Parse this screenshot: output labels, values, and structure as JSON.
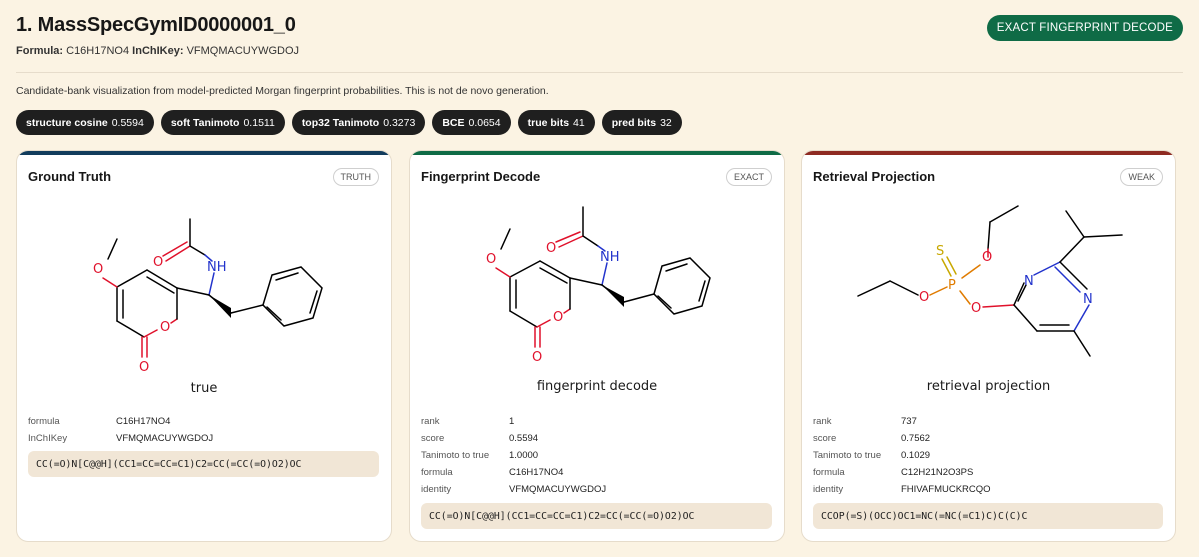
{
  "header": {
    "title": "1. MassSpecGymID0000001_0",
    "formula_label": "Formula:",
    "formula_value": "C16H17NO4",
    "inchikey_label": "InChIKey:",
    "inchikey_value": "VFMQMACUYWGDOJ",
    "mode_button": "EXACT FINGERPRINT DECODE"
  },
  "caption": "Candidate-bank visualization from model-predicted Morgan fingerprint probabilities. This is not de novo generation.",
  "metrics": [
    {
      "key": "structure cosine",
      "value": "0.5594"
    },
    {
      "key": "soft Tanimoto",
      "value": "0.1511"
    },
    {
      "key": "top32 Tanimoto",
      "value": "0.3273"
    },
    {
      "key": "BCE",
      "value": "0.0654"
    },
    {
      "key": "true bits",
      "value": "41"
    },
    {
      "key": "pred bits",
      "value": "32"
    }
  ],
  "cards": [
    {
      "title": "Ground Truth",
      "badge": "TRUTH",
      "accent": "#123c5c",
      "mol_label": "true",
      "props": [
        {
          "k": "formula",
          "v": "C16H17NO4"
        },
        {
          "k": "InChIKey",
          "v": "VFMQMACUYWGDOJ"
        }
      ],
      "smiles": "CC(=O)N[C@@H](CC1=CC=CC=C1)C2=CC(=CC(=O)O2)OC"
    },
    {
      "title": "Fingerprint Decode",
      "badge": "EXACT",
      "accent": "#0f6b46",
      "mol_label": "fingerprint decode",
      "props": [
        {
          "k": "rank",
          "v": "1"
        },
        {
          "k": "score",
          "v": "0.5594"
        },
        {
          "k": "Tanimoto to true",
          "v": "1.0000"
        },
        {
          "k": "formula",
          "v": "C16H17NO4"
        },
        {
          "k": "identity",
          "v": "VFMQMACUYWGDOJ"
        }
      ],
      "smiles": "CC(=O)N[C@@H](CC1=CC=CC=C1)C2=CC(=CC(=O)O2)OC"
    },
    {
      "title": "Retrieval Projection",
      "badge": "WEAK",
      "accent": "#8e2b22",
      "mol_label": "retrieval projection",
      "props": [
        {
          "k": "rank",
          "v": "737"
        },
        {
          "k": "score",
          "v": "0.7562"
        },
        {
          "k": "Tanimoto to true",
          "v": "0.1029"
        },
        {
          "k": "formula",
          "v": "C12H21N2O3PS"
        },
        {
          "k": "identity",
          "v": "FHIVAFMUCKRCQO"
        }
      ],
      "smiles": "CCOP(=S)(OCC)OC1=NC(=NC(=C1)C)C(C)C"
    }
  ],
  "atoms": {
    "O": "O",
    "N": "N",
    "NH": "NH",
    "P": "P",
    "S": "S"
  },
  "colors": {
    "oxygen": "#e0112b",
    "nitrogen": "#2233cc",
    "phosphorus": "#e07b00",
    "sulfur": "#c8a800"
  }
}
